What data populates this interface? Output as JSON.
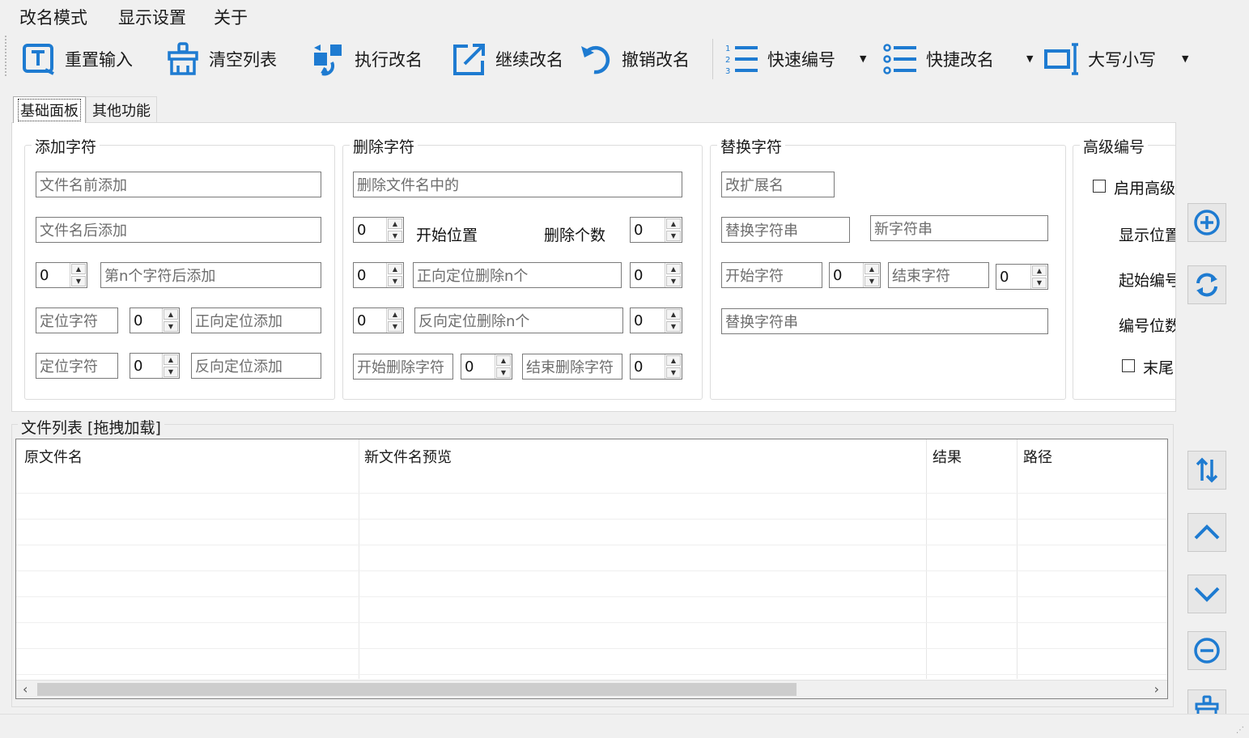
{
  "menu": {
    "items": [
      "改名模式",
      "显示设置",
      "关于"
    ]
  },
  "toolbar": {
    "reset_input": "重置输入",
    "clear_list": "清空列表",
    "execute_rename": "执行改名",
    "continue_rename": "继续改名",
    "undo_rename": "撤销改名",
    "quick_number": "快速编号",
    "quick_rename": "快捷改名",
    "case": "大写小写",
    "accent_color": "#1e7bd1"
  },
  "tabs": {
    "basic": "基础面板",
    "other": "其他功能"
  },
  "add_chars": {
    "title": "添加字符",
    "prefix_placeholder": "文件名前添加",
    "suffix_placeholder": "文件名后添加",
    "nth_value": "0",
    "nth_placeholder": "第n个字符后添加",
    "locate1_placeholder": "定位字符",
    "locate1_value": "0",
    "forward_add_placeholder": "正向定位添加",
    "locate2_placeholder": "定位字符",
    "locate2_value": "0",
    "reverse_add_placeholder": "反向定位添加"
  },
  "delete_chars": {
    "title": "删除字符",
    "delete_in_name_placeholder": "删除文件名中的",
    "start_pos_value": "0",
    "start_pos_label": "开始位置",
    "delete_count_label": "删除个数",
    "delete_count_value": "0",
    "forward_value": "0",
    "forward_placeholder": "正向定位删除n个",
    "forward_n_value": "0",
    "reverse_value": "0",
    "reverse_placeholder": "反向定位删除n个",
    "reverse_n_value": "0",
    "start_char_placeholder": "开始删除字符",
    "start_char_value": "0",
    "end_char_placeholder": "结束删除字符",
    "end_char_value": "0"
  },
  "replace_chars": {
    "title": "替换字符",
    "ext_placeholder": "改扩展名",
    "replace_str_placeholder": "替换字符串",
    "new_str_placeholder": "新字符串",
    "start_char_placeholder": "开始字符",
    "start_value": "0",
    "end_char_placeholder": "结束字符",
    "end_value": "0",
    "replace_str2_placeholder": "替换字符串"
  },
  "advanced_numbering": {
    "title": "高级编号",
    "enable_label": "启用高级",
    "display_pos_label": "显示位置",
    "start_num_label": "起始编号",
    "num_digits_label": "编号位数",
    "tail_label": "末尾"
  },
  "file_list": {
    "legend": "文件列表 [拖拽加载]",
    "columns": [
      "原文件名",
      "新文件名预览",
      "结果",
      "路径"
    ]
  },
  "side_buttons": [
    "add-circle-icon",
    "refresh-icon",
    "sort-icon",
    "chevron-up-icon",
    "chevron-down-icon",
    "minus-circle-icon",
    "broom-icon"
  ]
}
